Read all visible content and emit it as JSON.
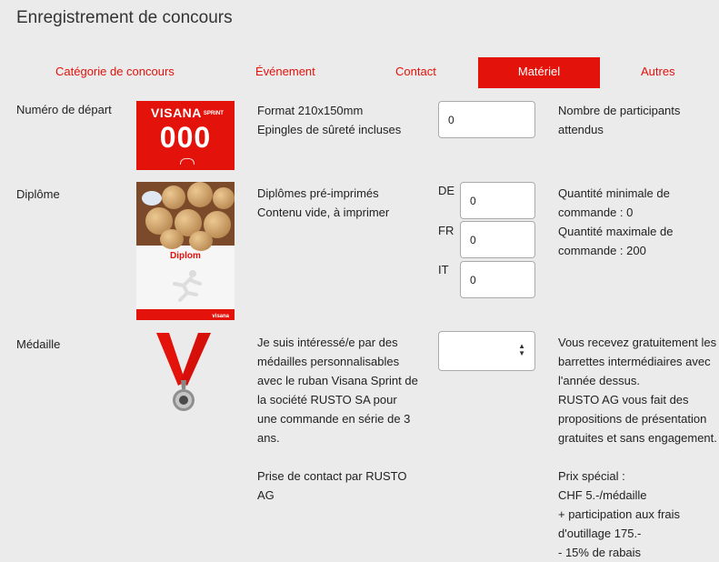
{
  "page": {
    "title": "Enregistrement de concours"
  },
  "tabs": [
    {
      "label": "Catégorie de concours"
    },
    {
      "label": "Événement"
    },
    {
      "label": "Contact"
    },
    {
      "label": "Matériel"
    },
    {
      "label": "Autres"
    }
  ],
  "colors": {
    "accent": "#e3120b",
    "background": "#ebebeb"
  },
  "start_number": {
    "label": "Numéro de départ",
    "image": {
      "brand": "VISANA",
      "brand_sub": "SPRINT",
      "number": "000"
    },
    "description": [
      "Format 210x150mm",
      "Epingles de sûreté incluses"
    ],
    "quantity_value": "0",
    "note": [
      "Nombre de participants",
      "attendus"
    ]
  },
  "diploma": {
    "label": "Diplôme",
    "image": {
      "word": "Diplom",
      "brand": "visana"
    },
    "description": [
      "Diplômes pré-imprimés",
      "Contenu vide, à imprimer"
    ],
    "inputs": [
      {
        "lang": "DE",
        "value": "0"
      },
      {
        "lang": "FR",
        "value": "0"
      },
      {
        "lang": "IT",
        "value": "0"
      }
    ],
    "note": [
      "Quantité minimale de",
      "commande : 0",
      "Quantité maximale de",
      "commande : 200"
    ]
  },
  "medal": {
    "label": "Médaille",
    "description": [
      "Je suis intéressé/e par des",
      "médailles personnalisables",
      "avec le ruban Visana Sprint de",
      "la société RUSTO SA pour",
      "une commande en série de 3",
      "ans."
    ],
    "contact": [
      "Prise de contact par RUSTO",
      "AG"
    ],
    "select_value": "",
    "note": [
      "Vous recevez gratuitement les",
      "barrettes intermédiaires avec",
      "l'année dessus.",
      "RUSTO AG vous fait des",
      "propositions de présentation",
      "gratuites et sans engagement."
    ],
    "price": [
      "Prix spécial :",
      "CHF 5.-/médaille",
      "+ participation aux frais",
      "d'outillage 175.-",
      "- 15% de rabais"
    ]
  }
}
